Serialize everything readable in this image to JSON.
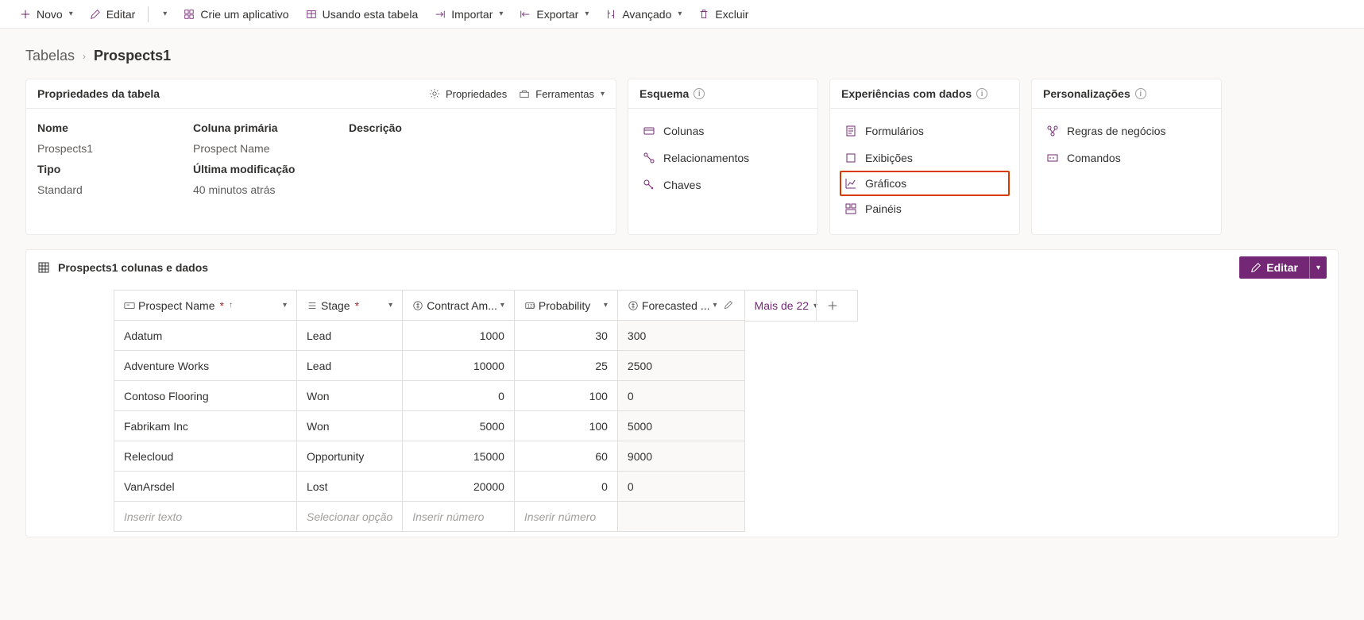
{
  "toolbar": {
    "new": "Novo",
    "edit": "Editar",
    "createApp": "Crie um aplicativo",
    "usingTable": "Usando esta tabela",
    "import": "Importar",
    "export": "Exportar",
    "advanced": "Avançado",
    "delete": "Excluir"
  },
  "breadcrumb": {
    "root": "Tabelas",
    "current": "Prospects1"
  },
  "propsCard": {
    "title": "Propriedades da tabela",
    "propsAction": "Propriedades",
    "toolsAction": "Ferramentas",
    "labels": {
      "name": "Nome",
      "primary": "Coluna primária",
      "desc": "Descrição",
      "type": "Tipo",
      "lastMod": "Última modificação"
    },
    "values": {
      "name": "Prospects1",
      "primary": "Prospect Name",
      "desc": "",
      "type": "Standard",
      "lastMod": "40 minutos atrás"
    }
  },
  "schemaCard": {
    "title": "Esquema",
    "columns": "Colunas",
    "relationships": "Relacionamentos",
    "keys": "Chaves"
  },
  "dataExpCard": {
    "title": "Experiências com dados",
    "forms": "Formulários",
    "views": "Exibições",
    "charts": "Gráficos",
    "dashboards": "Painéis"
  },
  "customCard": {
    "title": "Personalizações",
    "businessRules": "Regras de negócios",
    "commands": "Comandos"
  },
  "dataPanel": {
    "title": "Prospects1 colunas e dados",
    "editBtn": "Editar",
    "moreLabel": "Mais de 22",
    "columns": {
      "prospect": "Prospect Name",
      "stage": "Stage",
      "contract": "Contract Am...",
      "probability": "Probability",
      "forecast": "Forecasted ..."
    },
    "rows": [
      {
        "prospect": "Adatum",
        "stage": "Lead",
        "contract": "1000",
        "probability": "30",
        "forecast": "300"
      },
      {
        "prospect": "Adventure Works",
        "stage": "Lead",
        "contract": "10000",
        "probability": "25",
        "forecast": "2500"
      },
      {
        "prospect": "Contoso Flooring",
        "stage": "Won",
        "contract": "0",
        "probability": "100",
        "forecast": "0"
      },
      {
        "prospect": "Fabrikam Inc",
        "stage": "Won",
        "contract": "5000",
        "probability": "100",
        "forecast": "5000"
      },
      {
        "prospect": "Relecloud",
        "stage": "Opportunity",
        "contract": "15000",
        "probability": "60",
        "forecast": "9000"
      },
      {
        "prospect": "VanArsdel",
        "stage": "Lost",
        "contract": "20000",
        "probability": "0",
        "forecast": "0"
      }
    ],
    "placeholders": {
      "text": "Inserir texto",
      "option": "Selecionar opção",
      "number": "Inserir número"
    }
  }
}
